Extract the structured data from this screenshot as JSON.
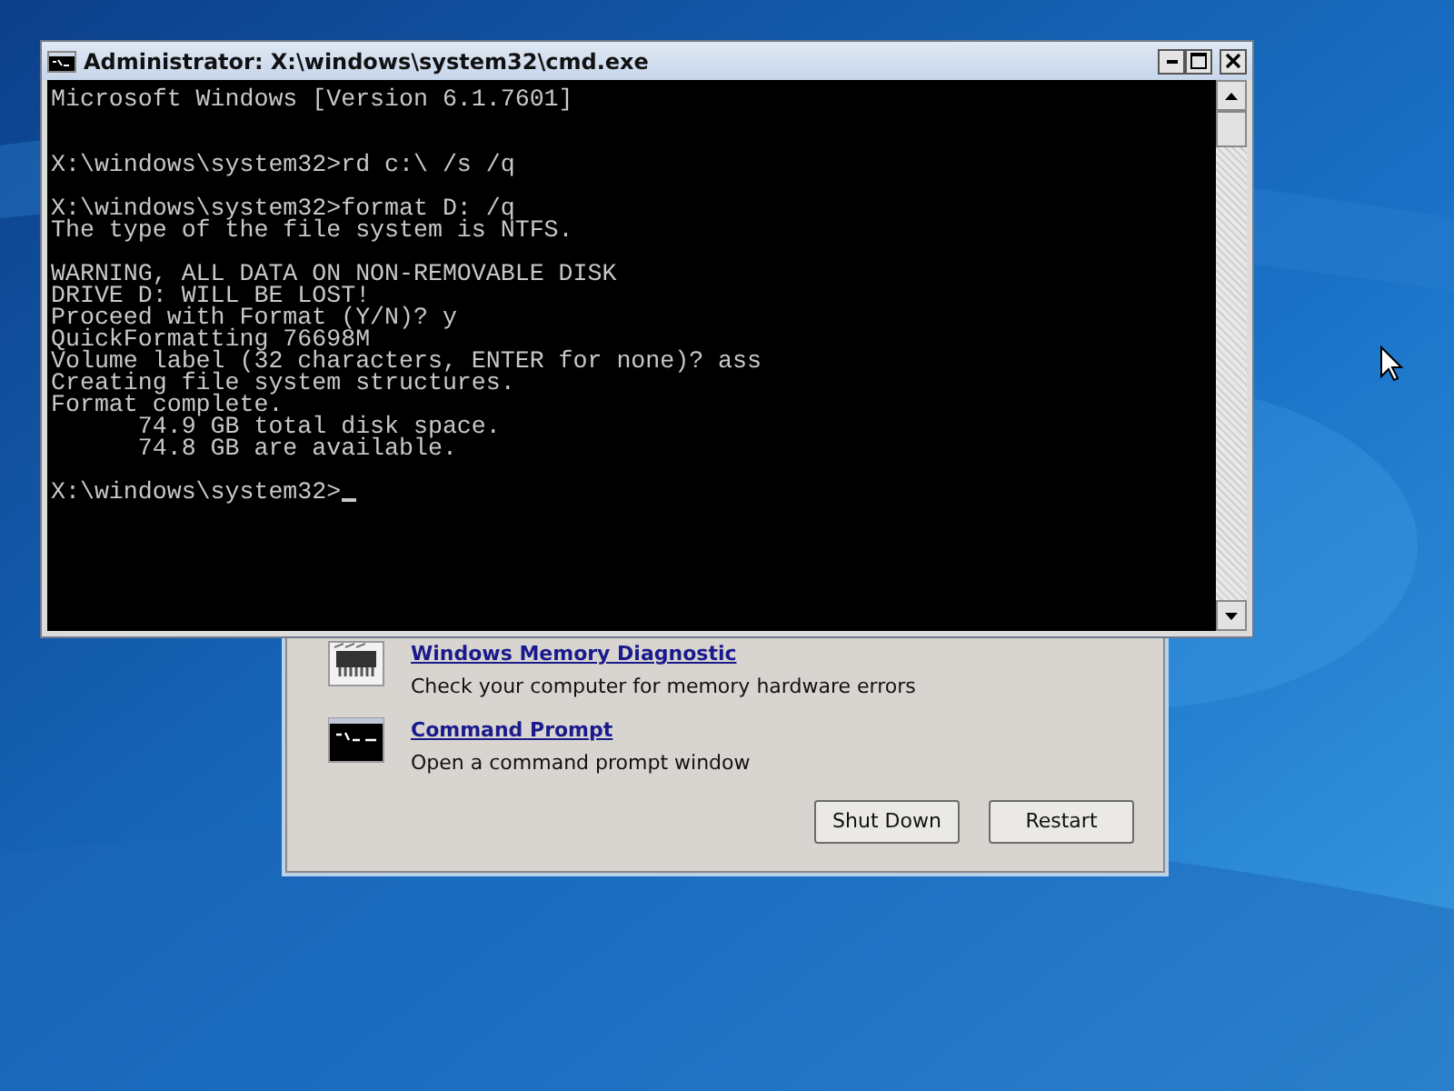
{
  "console_window": {
    "title": "Administrator: X:\\windows\\system32\\cmd.exe",
    "blocks": [
      [
        "Microsoft Windows [Version 6.1.7601]"
      ],
      [
        "X:\\windows\\system32>rd c:\\ /s /q"
      ],
      [
        "X:\\windows\\system32>format D: /q",
        "The type of the file system is NTFS."
      ],
      [
        "WARNING, ALL DATA ON NON-REMOVABLE DISK",
        "DRIVE D: WILL BE LOST!",
        "Proceed with Format (Y/N)? y",
        "QuickFormatting 76698M",
        "Volume label (32 characters, ENTER for none)? ass",
        "Creating file system structures.",
        "Format complete.",
        "      74.9 GB total disk space.",
        "      74.8 GB are available."
      ]
    ],
    "prompt": "X:\\windows\\system32>"
  },
  "recovery_dialog": {
    "tools": [
      {
        "kind": "memory",
        "name": "Windows Memory Diagnostic",
        "description": "Check your computer for memory hardware errors"
      },
      {
        "kind": "console",
        "name": "Command Prompt",
        "description": "Open a command prompt window"
      }
    ],
    "buttons": [
      "Shut Down",
      "Restart"
    ]
  }
}
